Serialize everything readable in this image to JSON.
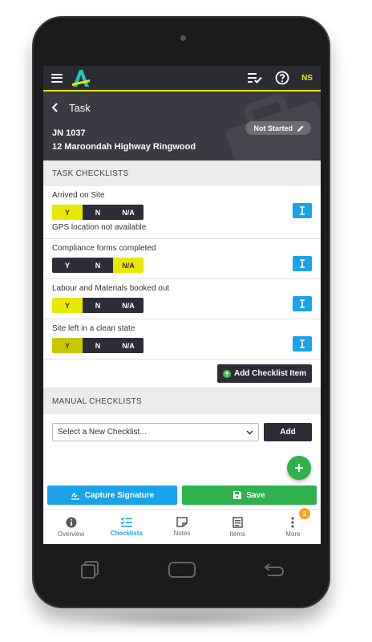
{
  "app": {
    "user_initials": "NS",
    "accent_color": "#e8e800",
    "primary_blue": "#1aa3e8",
    "success_green": "#2fb14c"
  },
  "header": {
    "title": "Task",
    "job_number": "JN 1037",
    "address": "12 Maroondah Highway Ringwood",
    "status": "Not Started"
  },
  "task_checklists": {
    "heading": "TASK CHECKLISTS",
    "options": [
      "Y",
      "N",
      "N/A"
    ],
    "items": [
      {
        "label": "Arrived on Site",
        "selected": "Y",
        "note": "GPS location not available"
      },
      {
        "label": "Compliance forms completed",
        "selected": "N/A"
      },
      {
        "label": "Labour and Materials booked out",
        "selected": "Y"
      },
      {
        "label": "Site left in a clean state",
        "selected": "Y"
      }
    ],
    "add_item_label": "Add Checklist Item"
  },
  "manual_checklists": {
    "heading": "MANUAL CHECKLISTS",
    "select_value": "Select a New Checklist...",
    "add_label": "Add"
  },
  "actions": {
    "capture_signature": "Capture Signature",
    "save": "Save"
  },
  "bottom_nav": {
    "overview": "Overview",
    "checklists": "Checklists",
    "notes": "Notes",
    "items": "Items",
    "more": "More",
    "more_badge": "2"
  },
  "icons": [
    "menu-icon",
    "logo-icon",
    "checklist-icon",
    "help-icon",
    "back-icon",
    "pencil-icon",
    "text-cursor-icon",
    "plus-icon",
    "chevron-down-icon",
    "signature-icon",
    "save-icon",
    "info-icon",
    "note-icon",
    "items-icon",
    "more-icon"
  ]
}
